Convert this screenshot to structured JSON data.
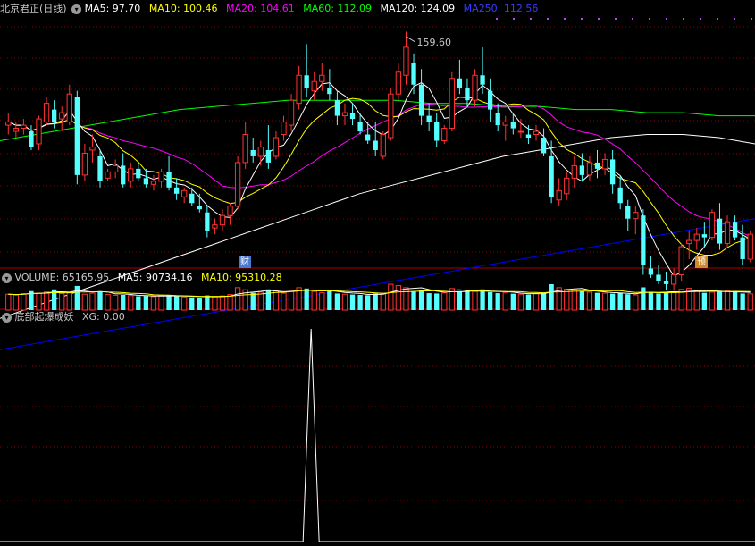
{
  "main_header": {
    "title": "北京君正(日线)",
    "ma": [
      {
        "label": "MA5: 97.70",
        "color": "#ffffff"
      },
      {
        "label": "MA10: 100.46",
        "color": "#ffff00"
      },
      {
        "label": "MA20: 104.61",
        "color": "#ff00ff"
      },
      {
        "label": "MA60: 112.09",
        "color": "#00ff00"
      },
      {
        "label": "MA120: 124.09",
        "color": "#ffffff"
      },
      {
        "label": "MA250: 112.56",
        "color": "#0000ff"
      }
    ]
  },
  "volume_header": {
    "title": "VOLUME: 65165.95",
    "ma5": "MA5: 90734.16",
    "ma10": "MA10: 95310.28"
  },
  "indicator_header": {
    "title": "底部起爆成妖",
    "xg": "XG: 0.00"
  },
  "markers": {
    "high_label": "159.60",
    "badge1": "财",
    "badge2": "预"
  },
  "colors": {
    "up": "#ff3232",
    "down": "#54ffff",
    "grid": "#8b0000",
    "border": "#b00000",
    "ma5": "#ffffff",
    "ma10": "#ffff00",
    "ma20": "#ff00ff",
    "ma60": "#00ff00",
    "ma120": "#ffffff",
    "ma250": "#0000ff"
  },
  "chart_data": {
    "type": "candlestick",
    "price_range": [
      85,
      165
    ],
    "high_marker": 159.6,
    "candles": [
      [
        130,
        134,
        127,
        131
      ],
      [
        128,
        131,
        126,
        129
      ],
      [
        129,
        132,
        127,
        130
      ],
      [
        128,
        130,
        122,
        123
      ],
      [
        124,
        133,
        122,
        132
      ],
      [
        131,
        139,
        130,
        137
      ],
      [
        135,
        138,
        129,
        131
      ],
      [
        132,
        136,
        128,
        134
      ],
      [
        131,
        143,
        130,
        140
      ],
      [
        139,
        141,
        111,
        114
      ],
      [
        114,
        124,
        112,
        121
      ],
      [
        122,
        127,
        118,
        123
      ],
      [
        120,
        122,
        110,
        112
      ],
      [
        113,
        116,
        112,
        115
      ],
      [
        115,
        119,
        113,
        117
      ],
      [
        117,
        121,
        110,
        111
      ],
      [
        112,
        118,
        110,
        116
      ],
      [
        116,
        118,
        112,
        113
      ],
      [
        113,
        116,
        110,
        111
      ],
      [
        111,
        114,
        109,
        112
      ],
      [
        112,
        116,
        110,
        115
      ],
      [
        115,
        120,
        109,
        110
      ],
      [
        110,
        113,
        106,
        108
      ],
      [
        107,
        110,
        105,
        109
      ],
      [
        108,
        110,
        104,
        105
      ],
      [
        104,
        108,
        102,
        103
      ],
      [
        102,
        104,
        94,
        96
      ],
      [
        97,
        100,
        95,
        98
      ],
      [
        98,
        103,
        96,
        101
      ],
      [
        101,
        105,
        98,
        104
      ],
      [
        104,
        120,
        103,
        118
      ],
      [
        118,
        131,
        116,
        127
      ],
      [
        122,
        126,
        118,
        120
      ],
      [
        120,
        125,
        117,
        123
      ],
      [
        122,
        130,
        116,
        118
      ],
      [
        120,
        128,
        119,
        126
      ],
      [
        127,
        133,
        125,
        131
      ],
      [
        130,
        140,
        128,
        138
      ],
      [
        137,
        149,
        135,
        146
      ],
      [
        146,
        156,
        139,
        142
      ],
      [
        141,
        147,
        138,
        144
      ],
      [
        144,
        150,
        141,
        146
      ],
      [
        142,
        148,
        138,
        140
      ],
      [
        138,
        141,
        130,
        133
      ],
      [
        133,
        137,
        130,
        134
      ],
      [
        134,
        137,
        130,
        132
      ],
      [
        131,
        134,
        127,
        128
      ],
      [
        127,
        131,
        124,
        125
      ],
      [
        125,
        131,
        120,
        122
      ],
      [
        120,
        128,
        119,
        127
      ],
      [
        126,
        142,
        125,
        140
      ],
      [
        140,
        150,
        138,
        147
      ],
      [
        146,
        160,
        143,
        155
      ],
      [
        150,
        153,
        140,
        143
      ],
      [
        143,
        148,
        130,
        133
      ],
      [
        133,
        137,
        128,
        131
      ],
      [
        131,
        134,
        123,
        125
      ],
      [
        125,
        130,
        124,
        129
      ],
      [
        129,
        147,
        128,
        145
      ],
      [
        145,
        151,
        140,
        142
      ],
      [
        142,
        145,
        136,
        138
      ],
      [
        138,
        148,
        136,
        146
      ],
      [
        146,
        155,
        140,
        143
      ],
      [
        141,
        145,
        131,
        135
      ],
      [
        134,
        137,
        128,
        130
      ],
      [
        130,
        133,
        125,
        131
      ],
      [
        131,
        134,
        127,
        129
      ],
      [
        128,
        132,
        126,
        128
      ],
      [
        127,
        130,
        124,
        126
      ],
      [
        127,
        130,
        125,
        128
      ],
      [
        126,
        129,
        120,
        121
      ],
      [
        120,
        125,
        105,
        107
      ],
      [
        106,
        113,
        104,
        109
      ],
      [
        108,
        115,
        106,
        113
      ],
      [
        113,
        120,
        110,
        117
      ],
      [
        117,
        121,
        112,
        114
      ],
      [
        114,
        120,
        112,
        118
      ],
      [
        118,
        122,
        113,
        116
      ],
      [
        116,
        121,
        114,
        119
      ],
      [
        119,
        122,
        108,
        111
      ],
      [
        110,
        114,
        103,
        105
      ],
      [
        104,
        106,
        96,
        100
      ],
      [
        100,
        104,
        95,
        102
      ],
      [
        101,
        103,
        82,
        85
      ],
      [
        84,
        88,
        81,
        82
      ],
      [
        82,
        85,
        79,
        80
      ],
      [
        80,
        83,
        77,
        79
      ],
      [
        79,
        84,
        77,
        82
      ],
      [
        82,
        92,
        80,
        91
      ],
      [
        92,
        96,
        87,
        93
      ],
      [
        93,
        97,
        90,
        95
      ],
      [
        95,
        99,
        91,
        94
      ],
      [
        94,
        103,
        93,
        102
      ],
      [
        100,
        105,
        90,
        92
      ],
      [
        92,
        101,
        91,
        99
      ],
      [
        99,
        101,
        93,
        94
      ],
      [
        94,
        98,
        85,
        87
      ],
      [
        87,
        96,
        86,
        95
      ]
    ],
    "ma_series": {
      "MA5": "moving average 5",
      "MA10": "moving average 10",
      "MA20": "moving average 20",
      "MA60": "moving average 60",
      "MA120": "moving average 120",
      "MA250": "moving average 250"
    },
    "ma60_approx": [
      125,
      127,
      129,
      131,
      133,
      135,
      136,
      137,
      138,
      138,
      138,
      138,
      137,
      137,
      136,
      136,
      135,
      135,
      134,
      134,
      133,
      133
    ],
    "ma120_approx": [
      68,
      72,
      76,
      80,
      84,
      88,
      92,
      96,
      100,
      104,
      108,
      111,
      114,
      117,
      120,
      122,
      124,
      126,
      127,
      127,
      126,
      124
    ],
    "ma250_approx": [
      58,
      60,
      62,
      64,
      66,
      68,
      70,
      72,
      74,
      76,
      78,
      80,
      82,
      84,
      86,
      88,
      90,
      92,
      94,
      96,
      98,
      100
    ],
    "volume": [
      92,
      88,
      95,
      110,
      98,
      105,
      120,
      96,
      100,
      140,
      92,
      98,
      105,
      90,
      86,
      88,
      84,
      80,
      82,
      78,
      84,
      88,
      80,
      76,
      74,
      72,
      85,
      78,
      82,
      90,
      130,
      118,
      100,
      104,
      120,
      112,
      98,
      110,
      130,
      125,
      108,
      100,
      115,
      96,
      92,
      90,
      88,
      86,
      96,
      98,
      150,
      142,
      130,
      110,
      115,
      98,
      96,
      100,
      125,
      110,
      112,
      108,
      120,
      104,
      98,
      102,
      95,
      92,
      90,
      96,
      98,
      150,
      130,
      120,
      116,
      110,
      104,
      100,
      98,
      95,
      100,
      92,
      88,
      132,
      104,
      96,
      100,
      102,
      120,
      126,
      110,
      100,
      104,
      108,
      112,
      104,
      96,
      94
    ],
    "indicator_xg_index": 39,
    "indicator_xg_value": 1
  }
}
